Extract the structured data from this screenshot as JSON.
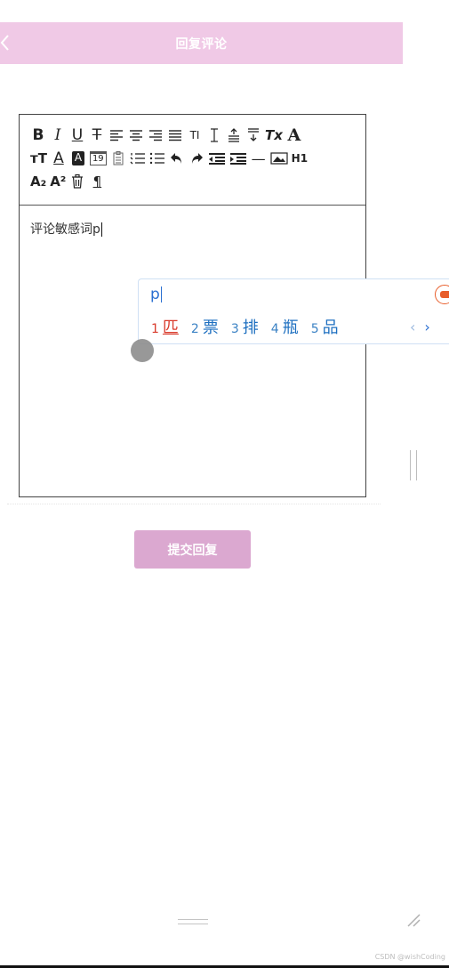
{
  "header": {
    "title": "回复评论",
    "back_icon": "chevron-left-icon",
    "background": "#f0c9e6"
  },
  "toolbar": {
    "rows": [
      [
        {
          "name": "bold-button",
          "label": "B"
        },
        {
          "name": "italic-button",
          "label": "I"
        },
        {
          "name": "underline-button",
          "label": "U"
        },
        {
          "name": "strikethrough-button",
          "label": "T"
        },
        {
          "name": "align-left-button",
          "icon": "align-left-icon"
        },
        {
          "name": "align-center-button",
          "icon": "align-center-icon"
        },
        {
          "name": "align-right-button",
          "icon": "align-right-icon"
        },
        {
          "name": "align-justify-button",
          "icon": "align-justify-icon"
        },
        {
          "name": "font-size-button",
          "label": "TI"
        },
        {
          "name": "letter-spacing-button",
          "icon": "text-cursor-icon"
        },
        {
          "name": "line-height-button",
          "icon": "line-height-icon"
        },
        {
          "name": "paragraph-spacing-button",
          "icon": "paragraph-spacing-icon"
        },
        {
          "name": "clear-format-button",
          "label": "Tx"
        },
        {
          "name": "font-family-button",
          "label": "A"
        }
      ],
      [
        {
          "name": "text-size-button",
          "label": "ᴛT"
        },
        {
          "name": "font-color-button",
          "label": "A"
        },
        {
          "name": "background-color-button",
          "label": "A"
        },
        {
          "name": "insert-date-button",
          "label": "19"
        },
        {
          "name": "insert-time-button",
          "icon": "clipboard-icon"
        },
        {
          "name": "ordered-list-button",
          "icon": "ordered-list-icon"
        },
        {
          "name": "unordered-list-button",
          "icon": "unordered-list-icon"
        },
        {
          "name": "undo-button",
          "icon": "undo-icon"
        },
        {
          "name": "redo-button",
          "icon": "redo-icon"
        },
        {
          "name": "outdent-button",
          "icon": "outdent-icon"
        },
        {
          "name": "indent-button",
          "icon": "indent-icon"
        },
        {
          "name": "horizontal-rule-button",
          "label": "—"
        },
        {
          "name": "insert-image-button",
          "icon": "image-icon"
        },
        {
          "name": "heading-button",
          "label": "H1"
        }
      ],
      [
        {
          "name": "subscript-button",
          "label": "A₂"
        },
        {
          "name": "superscript-button",
          "label": "A²"
        },
        {
          "name": "delete-button",
          "icon": "trash-icon"
        },
        {
          "name": "pilcrow-button",
          "label": "¶"
        }
      ]
    ]
  },
  "editor": {
    "content": "评论敏感词p"
  },
  "ime": {
    "input": "p",
    "candidates": [
      {
        "num": "1",
        "char": "匹"
      },
      {
        "num": "2",
        "char": "票"
      },
      {
        "num": "3",
        "char": "排"
      },
      {
        "num": "4",
        "char": "瓶"
      },
      {
        "num": "5",
        "char": "品"
      }
    ],
    "prev": "‹",
    "next": "›"
  },
  "submit": {
    "label": "提交回复",
    "color": "#dba8d0"
  },
  "watermark": "CSDN @wishCoding"
}
